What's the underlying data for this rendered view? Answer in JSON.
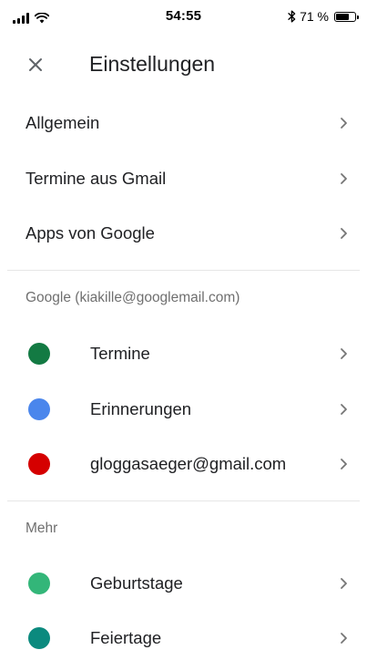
{
  "status_bar": {
    "time": "54:55",
    "battery_label": "71 %",
    "battery_level": 0.71,
    "bluetooth_icon": "bluetooth-icon"
  },
  "header": {
    "title": "Einstellungen",
    "close_icon": "close-icon"
  },
  "general": [
    {
      "label": "Allgemein"
    },
    {
      "label": "Termine aus Gmail"
    },
    {
      "label": "Apps von Google"
    }
  ],
  "account_section": {
    "title": "Google (kiakille@googlemail.com)",
    "items": [
      {
        "label": "Termine",
        "color": "#137a43"
      },
      {
        "label": "Erinnerungen",
        "color": "#4a86ec"
      },
      {
        "label": "gloggasaeger@gmail.com",
        "color": "#d50000"
      }
    ]
  },
  "more_section": {
    "title": "Mehr",
    "items": [
      {
        "label": "Geburtstage",
        "color": "#33b679"
      },
      {
        "label": "Feiertage",
        "color": "#0b8a7e"
      }
    ]
  }
}
